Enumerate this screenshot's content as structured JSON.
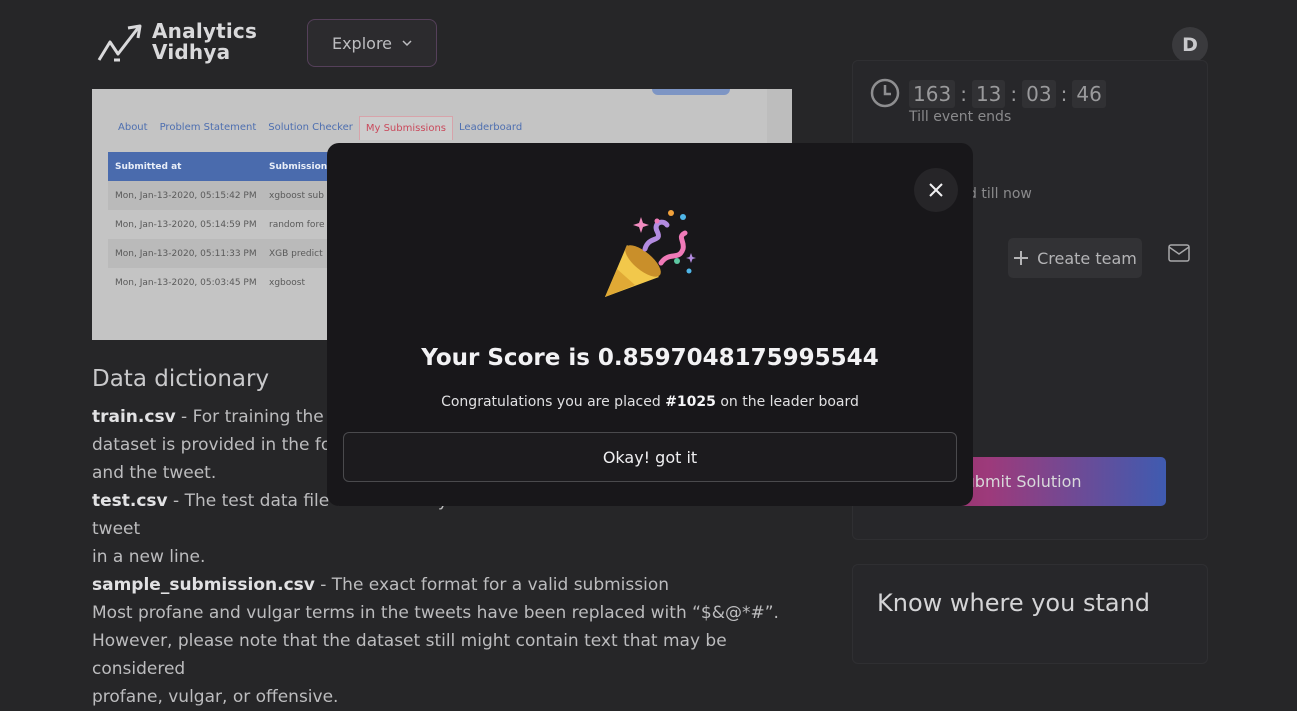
{
  "header": {
    "logo_line1": "Analytics",
    "logo_line2": "Vidhya",
    "explore_label": "Explore",
    "avatar_initial": "D"
  },
  "screenshot_preview": {
    "tabs": [
      "About",
      "Problem Statement",
      "Solution Checker",
      "My Submissions",
      "Leaderboard"
    ],
    "active_tab": "My Submissions",
    "columns": [
      "Submitted at",
      "Submission"
    ],
    "rows": [
      [
        "Mon, Jan-13-2020, 05:15:42 PM",
        "xgboost sub"
      ],
      [
        "Mon, Jan-13-2020, 05:14:59 PM",
        "random fore"
      ],
      [
        "Mon, Jan-13-2020, 05:11:33 PM",
        "XGB predict"
      ],
      [
        "Mon, Jan-13-2020, 05:03:45 PM",
        "xgboost"
      ]
    ]
  },
  "data_dictionary": {
    "title": "Data dictionary",
    "train_name": "train.csv",
    "train_desc_1": " - For training the m",
    "train_desc_2": "dataset is provided in the fo",
    "train_desc_3": "and the tweet.",
    "test_name": "test.csv",
    "test_desc_1": " - The test data file contains only tweet ids and the tweet text with each tweet",
    "test_desc_2": "in a new line.",
    "sample_name": "sample_submission.csv",
    "sample_desc": " - The exact format for a valid submission",
    "profane_1": "Most profane and vulgar terms in the tweets have been replaced with “$&@*#”.",
    "profane_2": "However, please note that the dataset still might contain text that may be considered",
    "profane_3": "profane, vulgar, or offensive."
  },
  "sidebar": {
    "timer": {
      "days": "163",
      "hours": "13",
      "minutes": "03",
      "seconds": "46"
    },
    "till_label": "Till event ends",
    "submitted_label": "d till now",
    "create_team_label": "Create team",
    "submit_label": "Submit Solution",
    "know_title": "Know where you stand"
  },
  "modal": {
    "score_text": "Your Score is 0.8597048175995544",
    "congrats_prefix": "Congratulations you are placed ",
    "rank": "#1025",
    "congrats_suffix": " on the leader board",
    "ok_label": "Okay! got it"
  },
  "colors": {
    "background": "#262628",
    "modal_bg": "#18171a",
    "submit_gradient_start": "#8a2c55",
    "submit_gradient_end": "#3f5bb0",
    "preview_header": "#4a6bad",
    "preview_active_tab": "#c94a5c"
  },
  "icons": [
    "logo-mark",
    "chevron-down-icon",
    "clock-icon",
    "plus-icon",
    "mail-icon",
    "close-icon",
    "party-popper-icon"
  ]
}
